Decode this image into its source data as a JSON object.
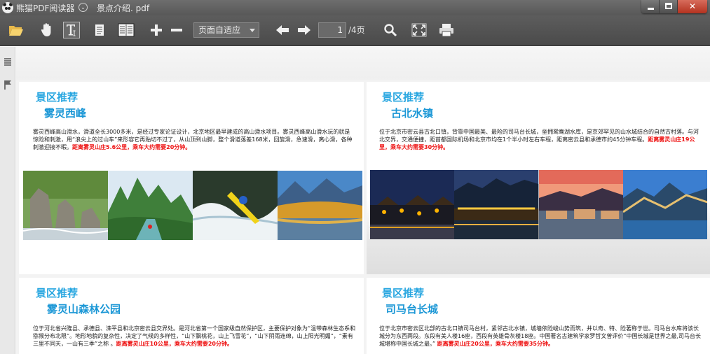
{
  "window": {
    "app_name": "熊猫PDF阅读器",
    "document_name": "景点介绍. pdf",
    "menu_glyph": "⌄",
    "close_glyph": "✕"
  },
  "toolbar": {
    "zoom_mode": "页面自适应",
    "current_page": "1",
    "total_pages_label": "/4页",
    "icons": [
      "open-folder-icon",
      "hand-tool-icon",
      "text-select-icon",
      "single-page-icon",
      "two-page-icon",
      "zoom-in-icon",
      "zoom-out-icon",
      "prev-page-icon",
      "next-page-icon",
      "search-icon",
      "fullscreen-icon",
      "print-icon"
    ]
  },
  "sidebar": {
    "icons": [
      "outline-list-icon",
      "bookmark-flag-icon"
    ]
  },
  "document": {
    "tag_label": "景区推荐",
    "panels": [
      {
        "title": "雾灵西峰",
        "body": "雾灵西峰高山滑水，滑道全长3000多米，是经过专家论证设计，北京地区最早建成的高山滑水项目。雾灵西峰高山滑水玩的就是惊险和刺激，用“浪尖上的过山车”来形容它再贴切不过了，从山顶到山脚，整个滑道落差168米，回旋滑，急速滑，离心滑，各种刺激迎接不暇。",
        "highlight": "距离雾灵山庄5.6公里，乘车大约需要20分钟。",
        "photos": [
          "rock-stream",
          "green-mountain-rafting",
          "whitewater-kayak",
          "autumn-lake"
        ]
      },
      {
        "title": "古北水镇",
        "body": "位于北京市密云县古北口镇，背靠中国最美、最险的司马台长城，坐拥鸳鸯湖水库，是京郊罕见的山水城结合的自然古村落。与河北交界，交通便捷，距首都国际机场和北京市均在1个半小时左右车程，距离密云县和承德市约45分钟车程。",
        "highlight": "距离雾灵山庄19公里，乘车大约需要30分钟。",
        "photos": [
          "night-lanterns",
          "night-town",
          "sunset-water-town",
          "evening-great-wall"
        ]
      },
      {
        "title": "雾灵山森林公园",
        "body": "位于河北省兴隆县、承德县、滦平县和北京密云县交界处。是河北省第一个国家级自然保护区，主要保护对象为“温带森林生态系和猕猴分布北限”。地形地貌的复杂性，决定了气候的多样性，“山下飘桃花，山上飞雪花”，“山下阴雨连绵，山上阳光明媚”，“素有三里不同天，一山有三季”之称 。",
        "highlight": "距离雾灵山庄10公里，乘车大约需要20分钟。"
      },
      {
        "title": "司马台长城",
        "body": "位于北京市密云区北部的古北口镇司马台村，紧邻古北水镇，城墙依险峻山势而筑，并以奇、特、险著称于世。司马台水库将该长城分为东西两段。东段有美人楼16座，西段有英雄骨灰楼18座。中国著名古建筑学家罗哲文曾评价“中国长城是世界之最,司马台长城堪称中国长城之最。” ",
        "highlight": "距离雾灵山庄20公里，乘车大约需要35分钟。"
      }
    ]
  },
  "colors": {
    "accent_blue": "#1b97d6",
    "highlight_red": "#ee1111",
    "toolbar_dark": "#4f4f4f"
  }
}
